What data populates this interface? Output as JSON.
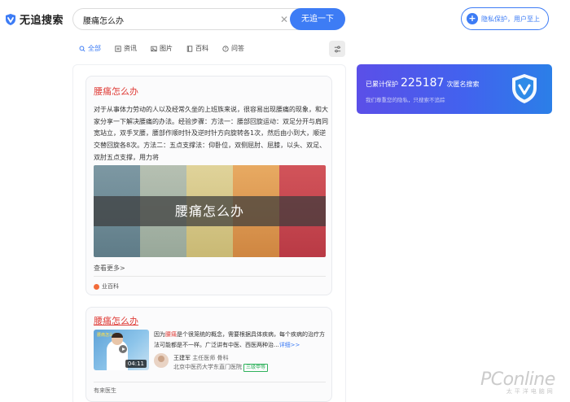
{
  "app": {
    "logo_text": "无追搜索",
    "logo_icon": "shield-v-logo"
  },
  "search": {
    "query": "腰痛怎么办",
    "clear_icon": "close-icon",
    "button_label": "无追一下"
  },
  "privacy_button": {
    "icon": "plus-circle-icon",
    "label": "隐私保护，用户至上"
  },
  "tabs": [
    {
      "label": "全部",
      "icon": "search-icon",
      "active": true
    },
    {
      "label": "资讯",
      "icon": "news-icon",
      "active": false
    },
    {
      "label": "图片",
      "icon": "image-icon",
      "active": false
    },
    {
      "label": "百科",
      "icon": "book-icon",
      "active": false
    },
    {
      "label": "问答",
      "icon": "question-icon",
      "active": false
    }
  ],
  "filter_icon": "sliders-icon",
  "results": {
    "baike": {
      "title": "腰痛怎么办",
      "body": "对于从事体力劳动的人以及经常久坐的上班族来说，很容易出现腰痛的现象，和大家分享一下解决腰痛的办法。经验步骤：方法一：腰部回旋运动：双足分开与肩同宽站立，双手叉腰，腰部作顺时针及逆时针方向旋转各1次，然后由小到大，顺逆交替回旋各8次。方法二：五点支撑法：仰卧位，双侧屈肘、屈膝，以头、双足、双肘五点支撑，用力将",
      "banner_text": "腰痛怎么办",
      "banner_colors": [
        "#6f8c98",
        "#a9b5a8",
        "#d6c98b",
        "#d99a55",
        "#c9474f"
      ],
      "more_label": "查看更多>",
      "source_label": "业百科"
    },
    "video": {
      "title": "腰痛怎么办",
      "thumb_caption": "腰痛怎么办",
      "duration": "04:11",
      "snippet_prefix": "因为",
      "snippet_highlight": "腰痛",
      "snippet_rest": "是个很笼统的概念，需要根据具体疾病，每个疾病的治疗方法可能都是不一样。广泛讲有中医、西医两种治...",
      "detail_label": "详细>>",
      "doctor_name": "王建军",
      "doctor_title": "主任医师",
      "doctor_dept": "骨科",
      "hospital": "北京中医药大学东直门医院",
      "hospital_tag": "三级甲等",
      "source_label": "有来医生"
    }
  },
  "promo": {
    "prefix": "已累计保护",
    "count": "225187",
    "suffix": "次匿名搜索",
    "subtitle": "我们尊重您的隐私，只搜索不追踪",
    "icon": "shield-icon"
  },
  "watermark": {
    "brand": "PConline",
    "sub": "太平洋电脑网"
  }
}
